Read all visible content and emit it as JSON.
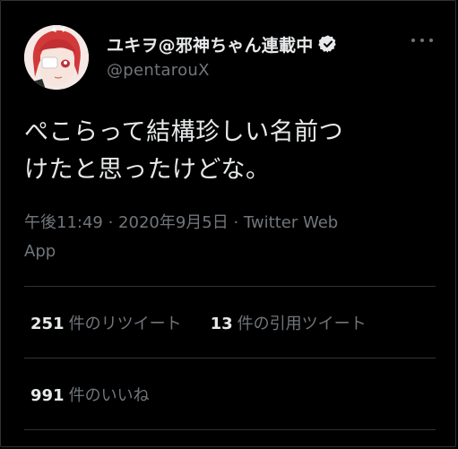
{
  "tweet": {
    "display_name": "ユキヲ@邪神ちゃん連載中",
    "handle": "@pentarouX",
    "verified": true,
    "text_lines": [
      "ぺこらって結構珍しい名前つ",
      "けたと思ったけどな。"
    ],
    "timestamp_line1": "午後11:49 · 2020年9月5日 · Twitter Web",
    "timestamp_line2": "App",
    "retweets": {
      "count": "251",
      "label": "件のリツイート"
    },
    "quotes": {
      "count": "13",
      "label": "件の引用ツイート"
    },
    "likes": {
      "count": "991",
      "label": "件のいいね"
    }
  },
  "icons": {
    "more": "more-horizontal-icon",
    "verified": "verified-badge-icon"
  },
  "colors": {
    "background": "#000000",
    "text_primary": "#e7e9ea",
    "text_secondary": "#71767b",
    "divider": "#2f3336"
  }
}
